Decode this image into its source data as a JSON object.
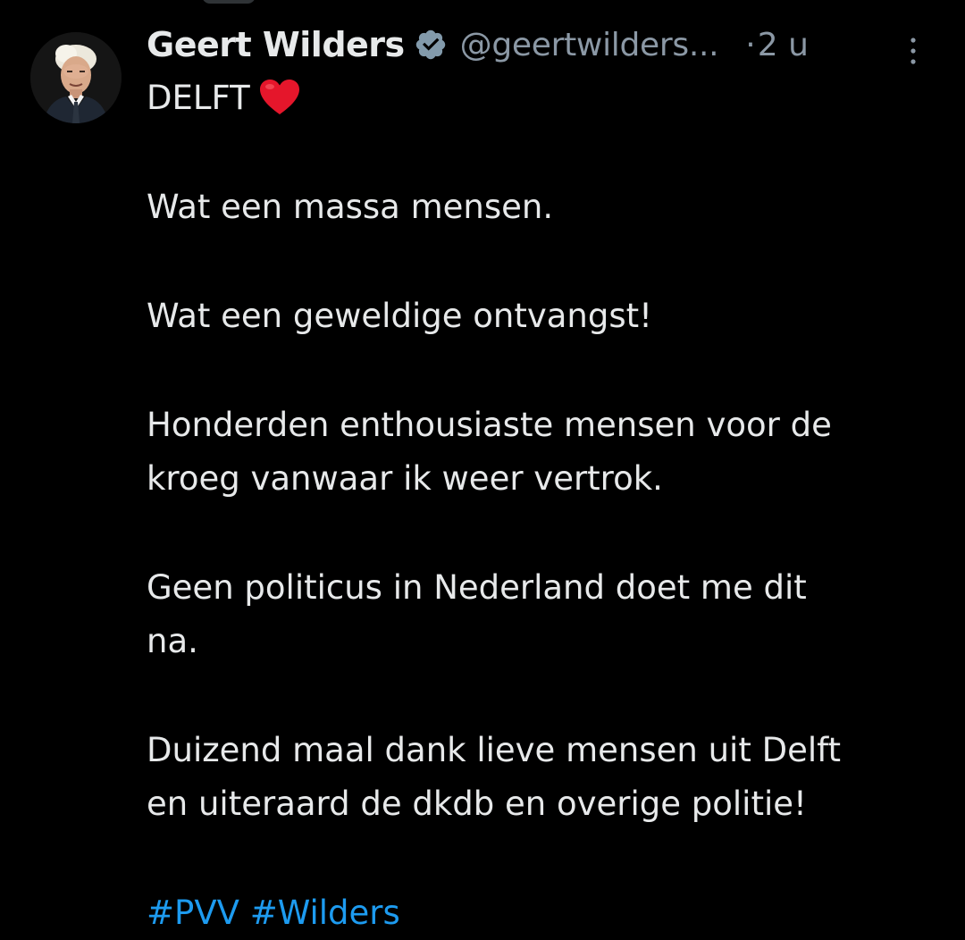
{
  "tweet": {
    "author": {
      "display_name": "Geert Wilders",
      "verified": true,
      "handle": "@geertwilders...",
      "avatar": "author-portrait"
    },
    "separator": "·",
    "time": "2 u",
    "more_icon": "more-vertical-icon",
    "body": {
      "first_line": "DELFT",
      "heart_icon": "red-heart-emoji",
      "paragraph_2": "Wat een massa mensen.",
      "paragraph_3": "Wat een geweldige ontvangst!",
      "paragraph_4_line_1": "Honderden enthousiaste mensen voor de",
      "paragraph_4_line_2": "kroeg vanwaar ik weer vertrok.",
      "paragraph_5_line_1": "Geen politicus in Nederland doet me dit",
      "paragraph_5_line_2": "na.",
      "paragraph_6_line_1": "Duizend maal dank lieve mensen uit Delft",
      "paragraph_6_line_2": "en uiteraard de dkdb en overige politie!",
      "hashtags": [
        "#PVV",
        "#Wilders"
      ]
    }
  },
  "colors": {
    "background": "#000000",
    "text": "#e7e9ea",
    "secondary_text": "#8b98a5",
    "link": "#1d9bf0",
    "heart": "#e5162b"
  }
}
